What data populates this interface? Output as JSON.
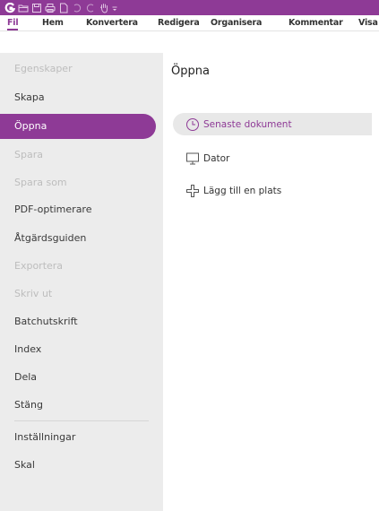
{
  "quick_access": {
    "icons": [
      "app-logo-icon",
      "open-folder-icon",
      "save-icon",
      "print-icon",
      "new-document-icon",
      "undo-icon",
      "redo-icon",
      "hand-tool-icon",
      "customize-dropdown-icon"
    ]
  },
  "menubar": {
    "items": [
      "Fil",
      "Hem",
      "Konvertera",
      "Redigera",
      "Organisera",
      "Kommentar",
      "Visa"
    ]
  },
  "sidebar": {
    "items": [
      {
        "label": "Egenskaper",
        "state": "disabled"
      },
      {
        "label": "Skapa",
        "state": "normal"
      },
      {
        "label": "Öppna",
        "state": "active"
      },
      {
        "label": "Spara",
        "state": "disabled"
      },
      {
        "label": "Spara som",
        "state": "disabled"
      },
      {
        "label": "PDF-optimerare",
        "state": "normal"
      },
      {
        "label": "Åtgärdsguiden",
        "state": "normal"
      },
      {
        "label": "Exportera",
        "state": "disabled"
      },
      {
        "label": "Skriv ut",
        "state": "disabled"
      },
      {
        "label": "Batchutskrift",
        "state": "normal"
      },
      {
        "label": "Index",
        "state": "normal"
      },
      {
        "label": "Dela",
        "state": "normal"
      },
      {
        "label": "Stäng",
        "state": "normal"
      },
      {
        "label": "Inställningar",
        "state": "normal"
      },
      {
        "label": "Skal",
        "state": "normal"
      }
    ]
  },
  "main": {
    "title": "Öppna",
    "options": [
      {
        "label": "Senaste dokument",
        "icon": "clock-icon",
        "selected": true
      },
      {
        "label": "Dator",
        "icon": "monitor-icon",
        "selected": false
      },
      {
        "label": "Lägg till en plats",
        "icon": "plus-icon",
        "selected": false
      }
    ]
  },
  "colors": {
    "accent": "#8e3a96",
    "sidebar_bg": "#ececec",
    "selected_option_bg": "#e8e8e8",
    "disabled_text": "#bdbdbd"
  }
}
